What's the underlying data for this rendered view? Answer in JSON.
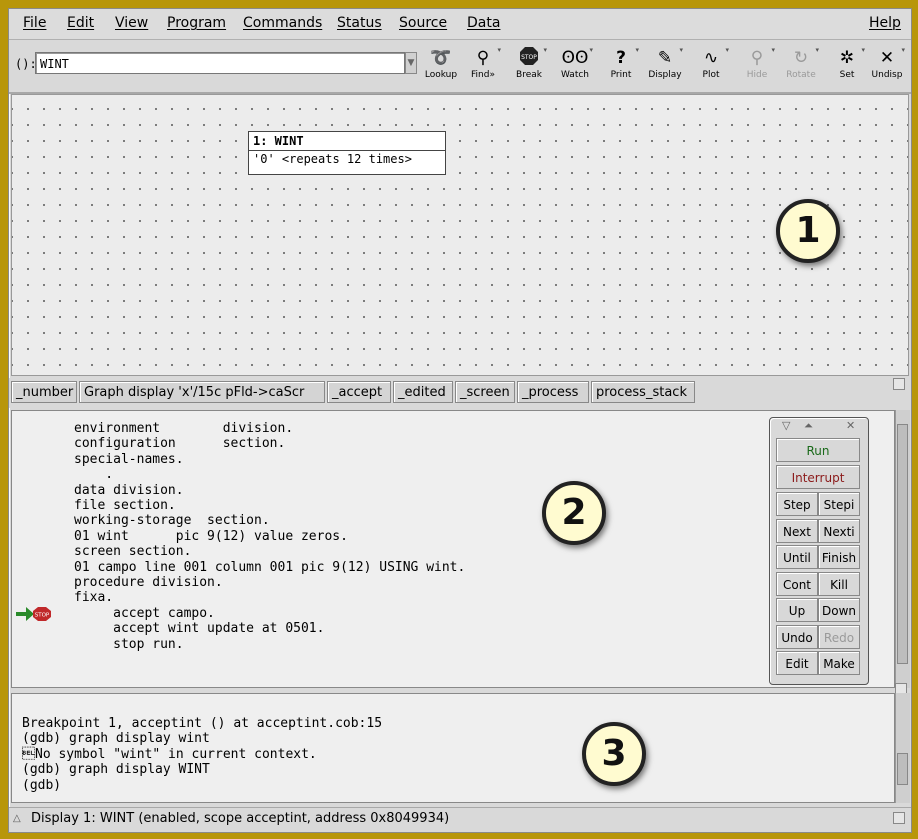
{
  "menu": {
    "file": "File",
    "edit": "Edit",
    "view": "View",
    "program": "Program",
    "commands": "Commands",
    "status": "Status",
    "source": "Source",
    "data": "Data",
    "help": "Help"
  },
  "toolbar": {
    "arg_label": "():",
    "arg_value": "WINT",
    "buttons": {
      "lookup": "Lookup",
      "find": "Find»",
      "break": "Break",
      "watch": "Watch",
      "print": "Print",
      "display": "Display",
      "plot": "Plot",
      "hide": "Hide",
      "rotate": "Rotate",
      "set": "Set",
      "undisp": "Undisp"
    }
  },
  "graph": {
    "node_title": "1: WINT",
    "node_value": "'0' <repeats 12 times>"
  },
  "badges": {
    "one": "1",
    "two": "2",
    "three": "3"
  },
  "display_tabs": [
    "_number",
    "Graph display 'x'/15c pFld->caScr",
    "_accept",
    "_edited",
    "_screen",
    "_process",
    "process_stack"
  ],
  "source_code": "environment        division.\nconfiguration      section.\nspecial-names.\n    .\ndata division.\nfile section.\nworking-storage  section.\n01 wint      pic 9(12) value zeros.\nscreen section.\n01 campo line 001 column 001 pic 9(12) USING wint.\nprocedure division.\nfixa.\n     accept campo.\n     accept wint update at 0501.\n     stop run.",
  "command_tool": {
    "run": "Run",
    "interrupt": "Interrupt",
    "step": "Step",
    "stepi": "Stepi",
    "next": "Next",
    "nexti": "Nexti",
    "until": "Until",
    "finish": "Finish",
    "cont": "Cont",
    "kill": "Kill",
    "up": "Up",
    "down": "Down",
    "undo": "Undo",
    "redo": "Redo",
    "edit": "Edit",
    "make": "Make"
  },
  "console_text": "Breakpoint 1, acceptint () at acceptint.cob:15\n(gdb) graph display wint\n\u0007No symbol \"wint\" in current context.\n(gdb) graph display WINT\n(gdb)",
  "status_text": "Display 1: WINT (enabled, scope acceptint, address 0x8049934)",
  "icons": {
    "lookup": "lookup-icon",
    "find": "binoculars-icon",
    "break": "stop-sign-icon",
    "watch": "eyes-icon",
    "print": "question-icon",
    "display": "display-icon",
    "plot": "plot-icon",
    "hide": "magnifier-icon",
    "rotate": "rotate-icon",
    "set": "set-icon",
    "undisp": "undisp-icon"
  },
  "colors": {
    "frame": "#b8960a",
    "run": "#1a6a1a",
    "interrupt": "#8b1a1a",
    "stop_sign": "#c0282a",
    "exec_arrow": "#2a8a2a"
  }
}
